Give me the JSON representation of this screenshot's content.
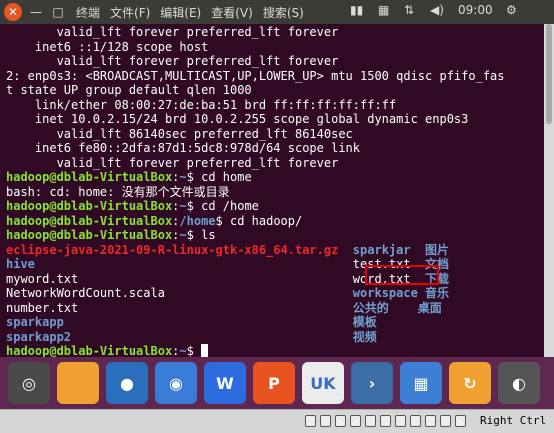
{
  "topbar": {
    "close_glyph": "✕",
    "minimize_glyph": "—",
    "maximize_glyph": "□",
    "title": "终端",
    "menus": [
      "文件(F)",
      "编辑(E)",
      "查看(V)",
      "搜索(S)"
    ],
    "time": "09:00"
  },
  "terminal": {
    "lines": [
      [
        {
          "t": "       valid_lft forever preferred_lft forever",
          "c": "white"
        }
      ],
      [
        {
          "t": "    inet6 ::1/128 scope host",
          "c": "white"
        }
      ],
      [
        {
          "t": "       valid_lft forever preferred_lft forever",
          "c": "white"
        }
      ],
      [
        {
          "t": "2: enp0s3: <BROADCAST,MULTICAST,UP,LOWER_UP> mtu 1500 qdisc pfifo_fas",
          "c": "white"
        }
      ],
      [
        {
          "t": "t state UP group default qlen 1000",
          "c": "white"
        }
      ],
      [
        {
          "t": "    link/ether 08:00:27:de:ba:51 brd ff:ff:ff:ff:ff:ff",
          "c": "white"
        }
      ],
      [
        {
          "t": "    inet 10.0.2.15/24 brd 10.0.2.255 scope global dynamic enp0s3",
          "c": "white"
        }
      ],
      [
        {
          "t": "       valid_lft 86140sec preferred_lft 86140sec",
          "c": "white"
        }
      ],
      [
        {
          "t": "    inet6 fe80::2dfa:87d1:5dc8:978d/64 scope link",
          "c": "white"
        }
      ],
      [
        {
          "t": "       valid_lft forever preferred_lft forever",
          "c": "white"
        }
      ],
      [
        {
          "t": "hadoop@dblab-VirtualBox",
          "c": "green"
        },
        {
          "t": ":",
          "c": "white"
        },
        {
          "t": "~",
          "c": "blue"
        },
        {
          "t": "$ cd home",
          "c": "white"
        }
      ],
      [
        {
          "t": "bash: cd: home: 没有那个文件或目录",
          "c": "white"
        }
      ],
      [
        {
          "t": "hadoop@dblab-VirtualBox",
          "c": "green"
        },
        {
          "t": ":",
          "c": "white"
        },
        {
          "t": "~",
          "c": "blue"
        },
        {
          "t": "$ cd /home",
          "c": "white"
        }
      ],
      [
        {
          "t": "hadoop@dblab-VirtualBox",
          "c": "green"
        },
        {
          "t": ":",
          "c": "white"
        },
        {
          "t": "/home",
          "c": "blue"
        },
        {
          "t": "$ cd hadoop/",
          "c": "white"
        }
      ],
      [
        {
          "t": "hadoop@dblab-VirtualBox",
          "c": "green"
        },
        {
          "t": ":",
          "c": "white"
        },
        {
          "t": "~",
          "c": "blue"
        },
        {
          "t": "$ ls",
          "c": "white"
        }
      ],
      [
        {
          "t": "eclipse-java-2021-09-R-linux-gtk-x86_64.tar.gz",
          "c": "red"
        },
        {
          "t": "  ",
          "c": "white"
        },
        {
          "t": "sparkjar",
          "c": "blue"
        },
        {
          "t": "  ",
          "c": "white"
        },
        {
          "t": "图片",
          "c": "blue"
        }
      ],
      [
        {
          "t": "hive",
          "c": "blue"
        },
        {
          "t": "                                            test.txt  ",
          "c": "white"
        },
        {
          "t": "文档",
          "c": "blue"
        }
      ],
      [
        {
          "t": "myword.txt                                      word.txt  ",
          "c": "white"
        },
        {
          "t": "下载",
          "c": "blue"
        }
      ],
      [
        {
          "t": "NetworkWordCount.scala                          ",
          "c": "white"
        },
        {
          "t": "workspace",
          "c": "blue"
        },
        {
          "t": " ",
          "c": "white"
        },
        {
          "t": "音乐",
          "c": "blue"
        }
      ],
      [
        {
          "t": "number.txt                                      ",
          "c": "white"
        },
        {
          "t": "公共的",
          "c": "blue"
        },
        {
          "t": "    ",
          "c": "white"
        },
        {
          "t": "桌面",
          "c": "blue"
        }
      ],
      [
        {
          "t": "sparkapp",
          "c": "blue"
        },
        {
          "t": "                                        ",
          "c": "white"
        },
        {
          "t": "模板",
          "c": "blue"
        }
      ],
      [
        {
          "t": "sparkapp2",
          "c": "blue"
        },
        {
          "t": "                                       ",
          "c": "white"
        },
        {
          "t": "视频",
          "c": "blue"
        }
      ],
      [
        {
          "t": "hadoop@dblab-VirtualBox",
          "c": "green"
        },
        {
          "t": ":",
          "c": "white"
        },
        {
          "t": "~",
          "c": "blue"
        },
        {
          "t": "$ ",
          "c": "white"
        }
      ]
    ]
  },
  "dock": {
    "items": [
      {
        "name": "ubuntu-logo-icon",
        "bg": "#4a4a4a",
        "glyph": "◎"
      },
      {
        "name": "files-folder-icon",
        "bg": "#f0a030",
        "glyph": ""
      },
      {
        "name": "firefox-icon",
        "bg": "#2a6fbb",
        "glyph": "●"
      },
      {
        "name": "chromium-icon",
        "bg": "#3a7bd5",
        "glyph": "◉"
      },
      {
        "name": "wps-writer-icon",
        "bg": "#2d6cdf",
        "glyph": "W"
      },
      {
        "name": "wps-presentation-icon",
        "bg": "#e8541f",
        "glyph": "P"
      },
      {
        "name": "ubuntu-kylin-icon",
        "bg": "#ececec",
        "glyph": "UK"
      },
      {
        "name": "terminal-icon",
        "bg": "#3b6ea5",
        "glyph": "›"
      },
      {
        "name": "apps-icon",
        "bg": "#3c7fd4",
        "glyph": "▦"
      },
      {
        "name": "update-icon",
        "bg": "#f0a030",
        "glyph": "↻"
      },
      {
        "name": "disk-icon",
        "bg": "#555555",
        "glyph": "◐"
      }
    ]
  },
  "statusbar": {
    "host_key": "Right Ctrl"
  }
}
